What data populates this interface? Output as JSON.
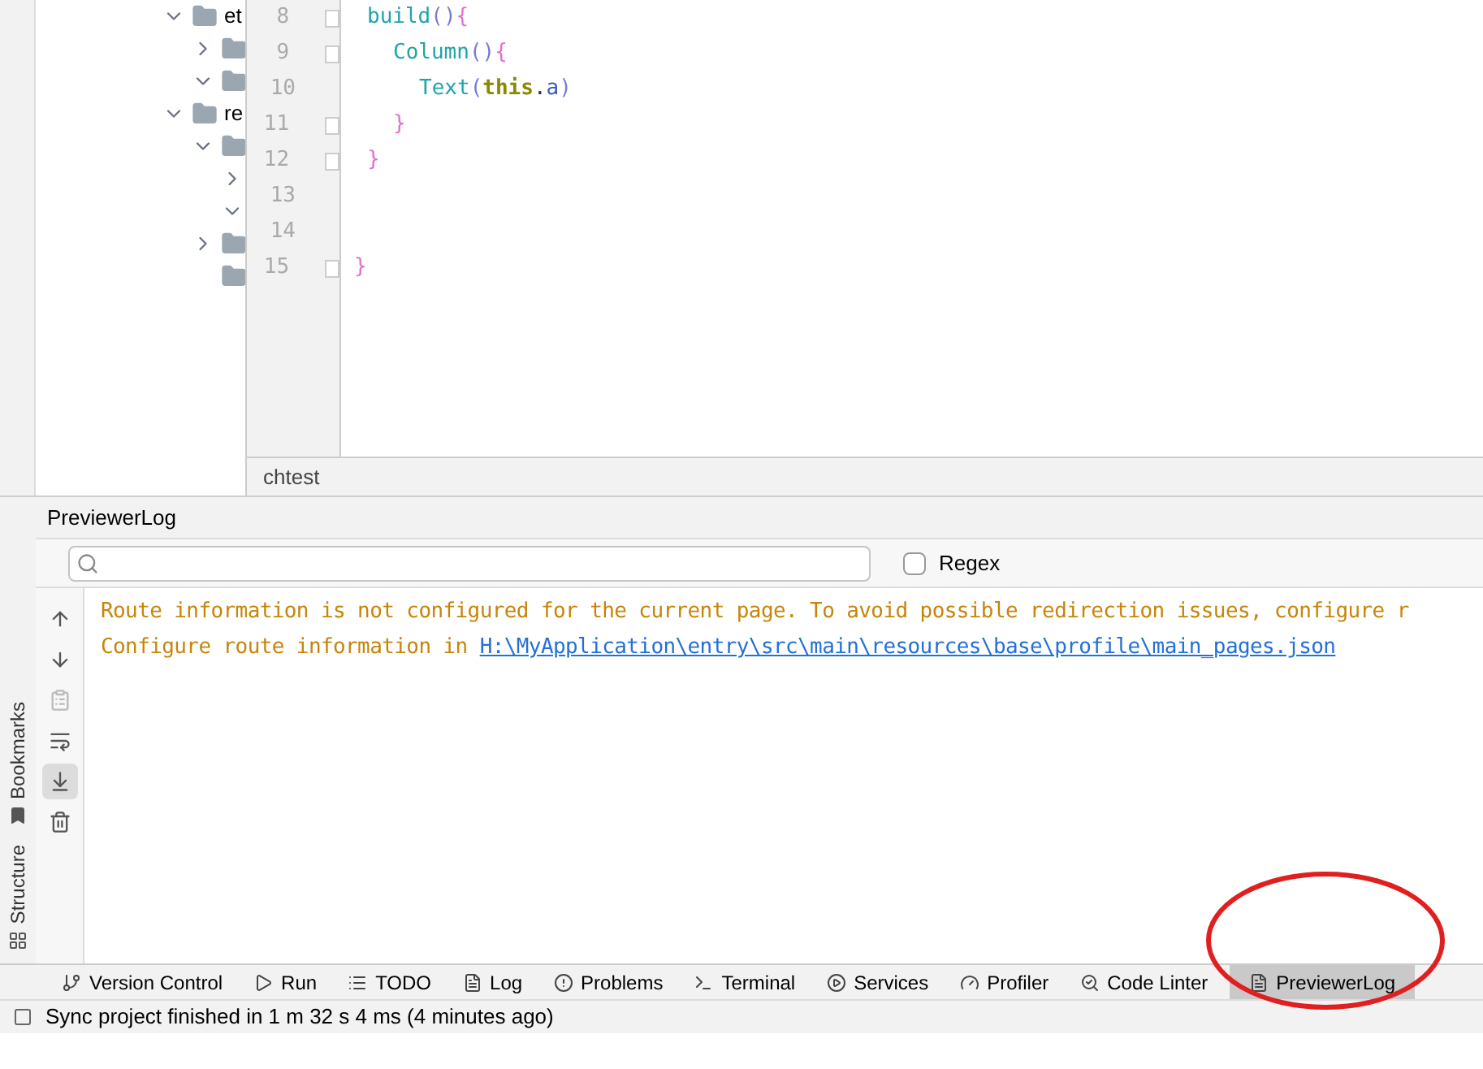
{
  "project_tree": [
    {
      "label": "et",
      "expanded": true,
      "children": [
        {
          "expanded": false
        },
        {
          "expanded": true
        }
      ]
    },
    {
      "label": "re",
      "expanded": true,
      "children": [
        {
          "expanded": true,
          "children": [
            {
              "expanded": false
            },
            {
              "expanded": true
            }
          ]
        },
        {
          "expanded": false
        },
        {
          "kind": "folder"
        }
      ]
    }
  ],
  "code_lines": [
    {
      "number": "8",
      "fold": true,
      "tokens": [
        {
          "kind": "func",
          "text": "build"
        },
        {
          "kind": "paren",
          "text": "()"
        },
        {
          "kind": "brace",
          "text": "{"
        }
      ],
      "children": [
        {
          "number": "9",
          "fold": true,
          "tokens": [
            {
              "kind": "func",
              "text": "Column"
            },
            {
              "kind": "paren",
              "text": "()"
            },
            {
              "kind": "brace",
              "text": "{"
            }
          ],
          "children": [
            {
              "number": "10",
              "fold": false,
              "tokens": [
                {
                  "kind": "func",
                  "text": "Text"
                },
                {
                  "kind": "paren",
                  "text": "("
                },
                {
                  "kind": "keyword",
                  "text": "this"
                },
                {
                  "kind": "plain",
                  "text": "."
                },
                {
                  "kind": "field",
                  "text": "a"
                },
                {
                  "kind": "paren",
                  "text": ")"
                }
              ]
            }
          ]
        },
        {
          "number": "11",
          "fold": true,
          "tokens": [
            {
              "kind": "brace",
              "text": "}"
            }
          ]
        }
      ]
    },
    {
      "number": "12",
      "fold": true,
      "tokens": [
        {
          "kind": "brace",
          "text": "}"
        }
      ]
    },
    {
      "number": "13",
      "fold": false
    },
    {
      "number": "14",
      "fold": false
    },
    {
      "number": "15",
      "fold": true,
      "outdent": true,
      "tokens": [
        {
          "kind": "brace",
          "text": "}"
        }
      ]
    }
  ],
  "breadcrumb": "chtest",
  "side_tabs": [
    {
      "label": "Bookmarks",
      "kind": "bookmark"
    },
    {
      "label": "Structure",
      "kind": "structure"
    }
  ],
  "log_panel": {
    "title": "PreviewerLog",
    "regex": {
      "label": "Regex",
      "checked": false
    },
    "tools": [
      {
        "kind": "up",
        "on": false,
        "disabled": false
      },
      {
        "kind": "down",
        "on": false,
        "disabled": false
      },
      {
        "kind": "clipboard",
        "on": false,
        "disabled": true
      },
      {
        "kind": "wrap",
        "on": false,
        "disabled": false
      },
      {
        "kind": "scroll-end",
        "on": true,
        "disabled": false
      },
      {
        "kind": "trash",
        "on": false,
        "disabled": false
      }
    ],
    "messages": [
      {
        "text": "Route information is not configured for the current page. To avoid possible redirection issues, configure r"
      },
      {
        "text": "Configure route information in ",
        "link": "H:\\MyApplication\\entry\\src\\main\\resources\\base\\profile\\main_pages.json"
      }
    ]
  },
  "tool_tabs": [
    {
      "label": "Version Control",
      "kind": "vcs",
      "selected": false
    },
    {
      "label": "Run",
      "kind": "run",
      "selected": false
    },
    {
      "label": "TODO",
      "kind": "todo",
      "selected": false
    },
    {
      "label": "Log",
      "kind": "log",
      "selected": false
    },
    {
      "label": "Problems",
      "kind": "problems",
      "selected": false
    },
    {
      "label": "Terminal",
      "kind": "terminal",
      "selected": false
    },
    {
      "label": "Services",
      "kind": "services",
      "selected": false
    },
    {
      "label": "Profiler",
      "kind": "profiler",
      "selected": false
    },
    {
      "label": "Code Linter",
      "kind": "linter",
      "selected": false
    },
    {
      "label": "PreviewerLog",
      "kind": "previewer",
      "selected": true
    }
  ],
  "status_bar": {
    "text": "Sync project finished in 1 m 32 s 4 ms (4 minutes ago)"
  }
}
